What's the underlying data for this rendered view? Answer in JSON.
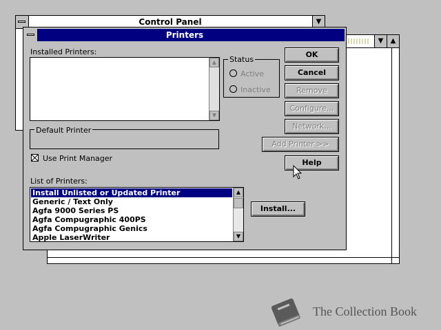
{
  "control_panel": {
    "title": "Control Panel",
    "minimize_glyph": "▼",
    "maximize_glyph": "▲"
  },
  "printers_dialog": {
    "title": "Printers",
    "installed_printers_label": "Installed Printers:",
    "status": {
      "label": "Status",
      "options": [
        "Active",
        "Inactive"
      ]
    },
    "default_printer_label": "Default Printer",
    "use_print_manager_label": "Use Print Manager",
    "use_print_manager_checked": true,
    "list_label": "List of Printers:",
    "printers": [
      "Install Unlisted or Updated Printer",
      "Generic / Text Only",
      "Agfa 9000 Series PS",
      "Agfa Compugraphic 400PS",
      "Agfa Compugraphic Genics",
      "Apple LaserWriter"
    ],
    "selected_index": 0,
    "buttons": {
      "ok": "OK",
      "cancel": "Cancel",
      "remove": "Remove",
      "configure": "Configure...",
      "network": "Network...",
      "add_printer": "Add Printer >>",
      "help": "Help",
      "install": "Install..."
    }
  },
  "watermark": {
    "text": "The Collection Book",
    "icon": "book-icon"
  }
}
